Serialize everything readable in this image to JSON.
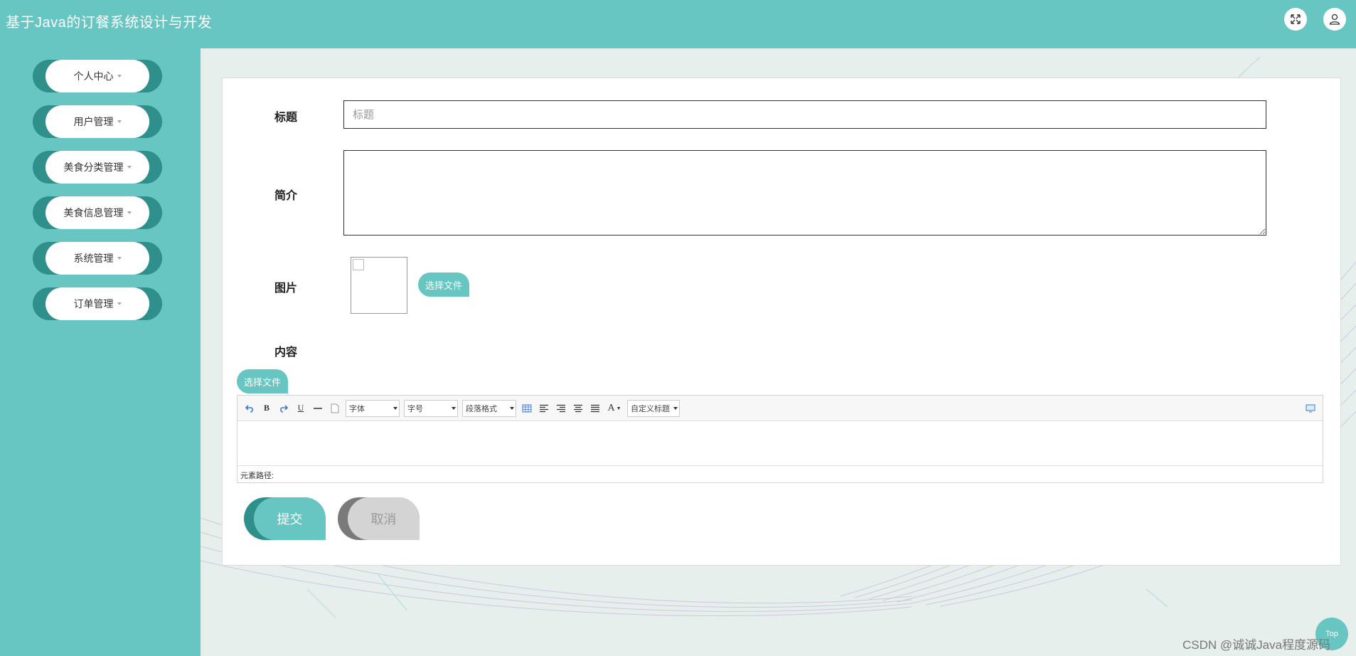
{
  "header": {
    "title": "基于Java的订餐系统设计与开发"
  },
  "sidebar": {
    "items": [
      {
        "label": "个人中心"
      },
      {
        "label": "用户管理"
      },
      {
        "label": "美食分类管理"
      },
      {
        "label": "美食信息管理"
      },
      {
        "label": "系统管理"
      },
      {
        "label": "订单管理"
      }
    ]
  },
  "form": {
    "title_label": "标题",
    "title_placeholder": "标题",
    "intro_label": "简介",
    "image_label": "图片",
    "image_upload_label": "选择文件",
    "content_label": "内容",
    "content_upload_label": "选择文件",
    "submit_label": "提交",
    "cancel_label": "取消"
  },
  "editor": {
    "font_family_select": "字体",
    "font_size_select": "字号",
    "paragraph_select": "段落格式",
    "custom_title_select": "自定义标题",
    "element_path_label": "元素路径:",
    "tool_icons": [
      "undo-icon",
      "bold-icon",
      "redo-icon",
      "underline-icon",
      "horizontal-rule-icon",
      "page-icon",
      "table-icon",
      "align-left-icon",
      "align-right-icon",
      "align-center-icon",
      "justify-icon",
      "font-color-icon",
      "fullscreen-icon"
    ]
  },
  "top_button": {
    "label": "Top"
  },
  "watermark": "CSDN @诚诚Java程度源码",
  "colors": {
    "primary": "#67c5c2",
    "primary_dark": "#2f8f8a",
    "background": "#e6efeb"
  }
}
